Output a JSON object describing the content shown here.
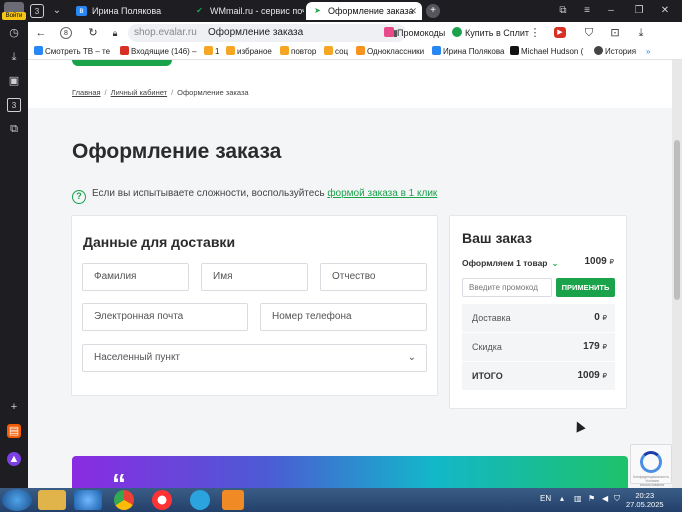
{
  "yandex_panel": {
    "login_label": "Войти",
    "icons": [
      "history-icon",
      "downloads-icon",
      "screenshot-icon",
      "tab-counter-icon",
      "collections-icon",
      "add-icon",
      "market-icon",
      "alice-icon"
    ],
    "tab_counter": "3"
  },
  "tabs": [
    {
      "label": "Ирина Полякова",
      "icon": "vk-icon",
      "color": "#2787f5"
    },
    {
      "label": "WMmail.ru - сервис почтовых",
      "icon": "wmmail-icon",
      "color": "#1aa34a"
    },
    {
      "label": "Оформление заказа",
      "icon": "evalar-icon",
      "color": "#1aa34a",
      "active": true
    }
  ],
  "tab_counter": "3",
  "address": {
    "host": "shop.evalar.ru",
    "page_title": "Оформление заказа",
    "ext_promo": "Промокоды",
    "ext_split": "Купить в Сплит"
  },
  "bookmarks": [
    {
      "label": "Смотреть ТВ – те",
      "color": "#2787f5"
    },
    {
      "label": "Входящие (146) –",
      "color": "#d93025"
    },
    {
      "label": "1",
      "color": "#f5a623"
    },
    {
      "label": "избраное",
      "color": "#f5a623"
    },
    {
      "label": "повтор",
      "color": "#f5a623"
    },
    {
      "label": "соц",
      "color": "#f5a623"
    },
    {
      "label": "Одноклассники",
      "color": "#f7931e"
    },
    {
      "label": "Ирина Полякова",
      "color": "#2787f5"
    },
    {
      "label": "Michael Hudson (",
      "color": "#111111"
    },
    {
      "label": "История",
      "color": "#444444"
    }
  ],
  "breadcrumbs": [
    "Главная",
    "Личный кабинет",
    "Оформление заказа"
  ],
  "page_title": "Оформление заказа",
  "help": {
    "text": "Если вы испытываете сложности, воспользуйтесь",
    "link": "формой заказа в 1 клик"
  },
  "delivery": {
    "title": "Данные для доставки",
    "fields": {
      "last_name": "Фамилия",
      "first_name": "Имя",
      "middle_name": "Отчество",
      "email": "Электронная почта",
      "phone": "Номер телефона",
      "city": "Населенный пункт"
    }
  },
  "order": {
    "title": "Ваш заказ",
    "count_label": "Оформляем 1 товар",
    "price": "1009",
    "currency": "₽",
    "promo_placeholder": "Введите промокод",
    "apply_label": "ПРИМЕНИТЬ",
    "rows": [
      {
        "label": "Доставка",
        "value": "0"
      },
      {
        "label": "Скидка",
        "value": "179"
      },
      {
        "label": "ИТОГО",
        "value": "1009"
      }
    ]
  },
  "recaptcha_text": "Конфиденциальность - Условия использования",
  "taskbar": {
    "lang": "EN",
    "time": "20:23",
    "date": "27.05.2025",
    "apps": [
      "explorer-icon",
      "ie-icon",
      "chrome-icon",
      "yandex-icon",
      "telegram-icon",
      "media-icon"
    ]
  },
  "colors": {
    "brand_green": "#1aa34a",
    "tab_bg": "#1d1d22"
  }
}
